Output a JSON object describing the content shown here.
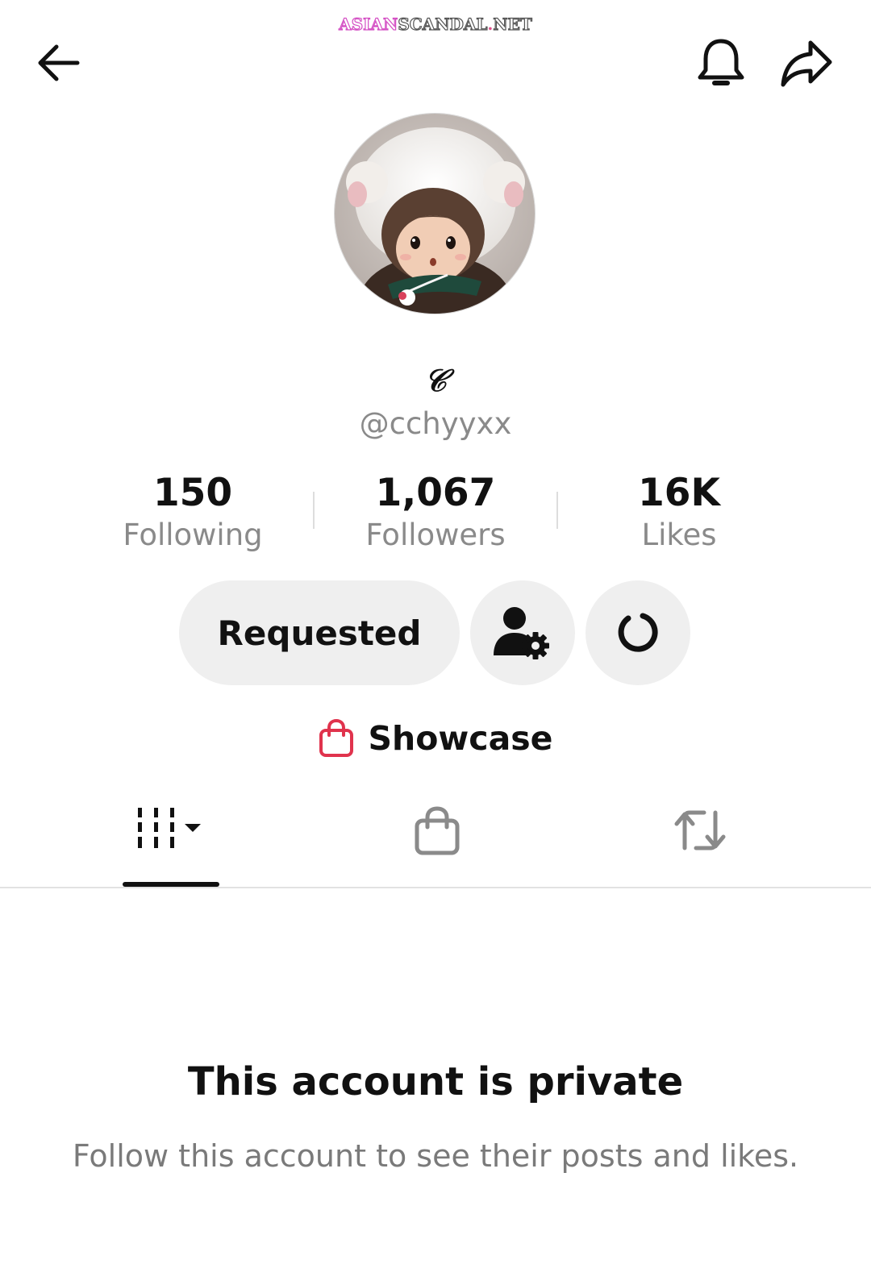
{
  "watermark": {
    "part1": "Asian",
    "part2": "Scandal",
    "dot": ".",
    "part3": "Net"
  },
  "nav": {
    "back_icon": "arrow-left-icon",
    "notification_icon": "bell-icon",
    "share_icon": "share-arrow-icon"
  },
  "profile": {
    "display_name": "𝒞",
    "handle": "@cchyyxx"
  },
  "stats": {
    "following": {
      "value": "150",
      "label": "Following"
    },
    "followers": {
      "value": "1,067",
      "label": "Followers"
    },
    "likes": {
      "value": "16K",
      "label": "Likes"
    }
  },
  "actions": {
    "requested_label": "Requested",
    "manage_icon": "person-gear-icon",
    "refresh_icon": "refresh-icon"
  },
  "showcase": {
    "label": "Showcase",
    "icon": "shopping-bag-icon"
  },
  "tabs": [
    {
      "name": "videos",
      "icon": "grid-bars-dropdown-icon",
      "active": true
    },
    {
      "name": "shop",
      "icon": "shopping-bag-icon",
      "active": false
    },
    {
      "name": "reposts",
      "icon": "repost-icon",
      "active": false
    }
  ],
  "private_notice": {
    "title": "This account is private",
    "subtitle": "Follow this account to see their posts and likes."
  },
  "colors": {
    "accent_pink": "#e0334d",
    "button_bg": "#efefef",
    "muted_text": "#8a8a8a",
    "primary_text": "#111111"
  }
}
